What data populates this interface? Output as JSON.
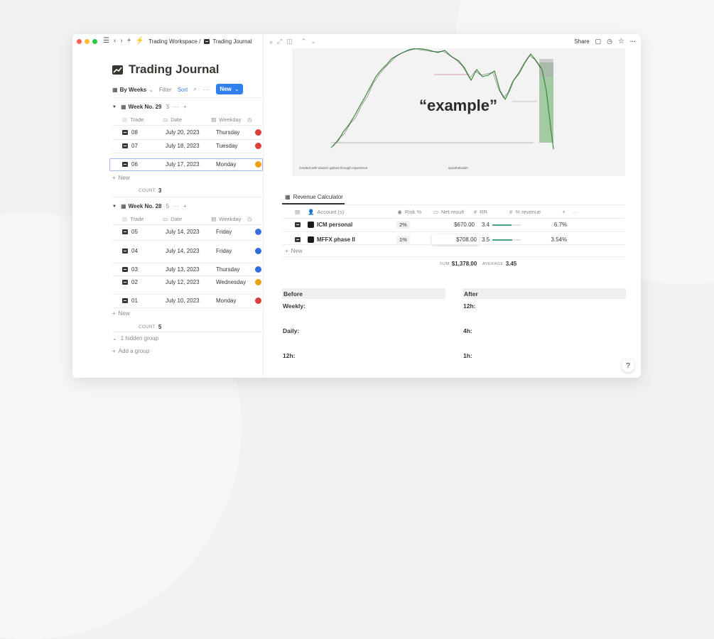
{
  "topbar": {
    "breadcrumb_workspace": "Trading Workspace /",
    "breadcrumb_page": "Trading Journal",
    "share": "Share"
  },
  "page": {
    "title": "Trading Journal",
    "view_label": "By Weeks",
    "filter": "Filter",
    "sort": "Sort",
    "new_button": "New"
  },
  "columns": {
    "trade": "Trade",
    "date": "Date",
    "weekday": "Weekday"
  },
  "groups": [
    {
      "label": "Week No. 29",
      "count": "3",
      "rows": [
        {
          "trade": "08",
          "date": "July 20, 2023",
          "weekday": "Thursday",
          "avatar_color": "#d9403a"
        },
        {
          "trade": "07",
          "date": "July 18, 2023",
          "weekday": "Tuesday",
          "avatar_color": "#d9403a"
        },
        {
          "trade": "06",
          "date": "July 17, 2023",
          "weekday": "Monday",
          "avatar_color": "#e8a317"
        }
      ],
      "new_label": "New",
      "count_label": "COUNT",
      "count_value": "3"
    },
    {
      "label": "Week No. 28",
      "count": "5",
      "rows": [
        {
          "trade": "05",
          "date": "July 14, 2023",
          "weekday": "Friday",
          "avatar_color": "#3a6fd9"
        },
        {
          "trade": "04",
          "date": "July 14, 2023",
          "weekday": "Friday",
          "avatar_color": "#2f6fd9"
        },
        {
          "trade": "03",
          "date": "July 13, 2023",
          "weekday": "Thursday",
          "avatar_color": "#2f6fd9"
        },
        {
          "trade": "02",
          "date": "July 12, 2023",
          "weekday": "Wednesday",
          "avatar_color": "#e8a317"
        },
        {
          "trade": "01",
          "date": "July 10, 2023",
          "weekday": "Monday",
          "avatar_color": "#d9403a"
        }
      ],
      "new_label": "New",
      "count_label": "COUNT",
      "count_value": "5"
    }
  ],
  "hidden_group": "1 hidden group",
  "add_group": "Add a group",
  "chart_image": {
    "overlay_text": "“example”",
    "footer_left": "Created with wisdom gained through experience.",
    "footer_center": "quanthetrader"
  },
  "calculator": {
    "tab": "Revenue Calculator",
    "headers": {
      "account": "Account (s)",
      "risk": "Risk %",
      "net": "Net result",
      "rr": "RR",
      "revenue": "% revenue"
    },
    "rows": [
      {
        "account": "ICM personal",
        "risk": "2%",
        "net": "$670.00",
        "rr": "3.4",
        "rr_fraction": 0.68,
        "revenue": "6.7%"
      },
      {
        "account": "MFFX phase II",
        "risk": "1%",
        "net": "$708.00",
        "rr": "3.5",
        "rr_fraction": 0.7,
        "revenue": "3.54%"
      }
    ],
    "new_label": "New",
    "sum_label": "SUM",
    "sum_value": "$1,378.00",
    "avg_label": "AVERAGE",
    "avg_value": "3.45"
  },
  "before": {
    "heading": "Before",
    "items": [
      "Weekly:",
      "Daily:",
      "12h:"
    ]
  },
  "after": {
    "heading": "After",
    "items": [
      "12h:",
      "4h:",
      "1h:"
    ]
  },
  "help": "?",
  "colors": {
    "accent": "#2f80ed",
    "rr_bar": "#4aa37c"
  }
}
